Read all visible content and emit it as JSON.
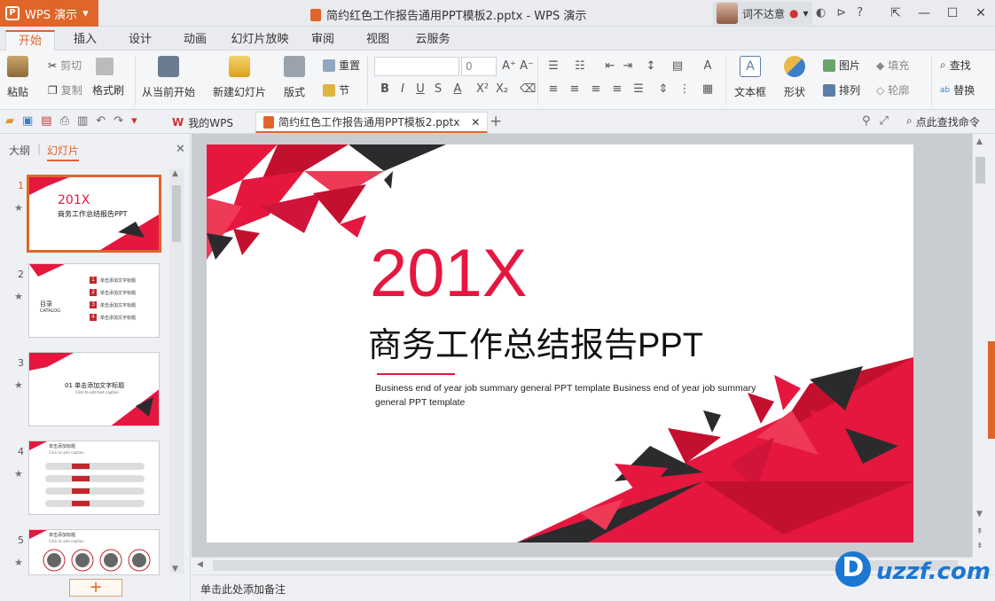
{
  "app": {
    "name": "WPS 演示",
    "doc_title": "简约红色工作报告通用PPT模板2.pptx - WPS 演示",
    "user": "词不达意"
  },
  "tabs": [
    "开始",
    "插入",
    "设计",
    "动画",
    "幻灯片放映",
    "审阅",
    "视图",
    "云服务"
  ],
  "ribbon": {
    "paste": "粘贴",
    "cut": "剪切",
    "copy": "复制",
    "format_painter": "格式刷",
    "from_current": "从当前开始",
    "new_slide": "新建幻灯片",
    "layout": "版式",
    "reset": "重置",
    "section": "节",
    "font_size": "0",
    "text_box": "文本框",
    "shape": "形状",
    "picture": "图片",
    "arrange": "排列",
    "fill": "填充",
    "outline": "轮廓",
    "find": "查找",
    "replace": "替换"
  },
  "doc_tabs": {
    "my_wps": "我的WPS",
    "file": "简约红色工作报告通用PPT模板2.pptx",
    "search": "点此查找命令"
  },
  "panel": {
    "outline_tab": "大纲",
    "slides_tab": "幻灯片",
    "add_button": "+"
  },
  "thumbnails": [
    {
      "num": "1",
      "year": "201X",
      "title": "商务工作总结报告PPT"
    },
    {
      "num": "2",
      "title": "目录",
      "subtitle": "CATALOG",
      "items": [
        "单击添加文字标题",
        "单击添加文字标题",
        "单击添加文字标题",
        "单击添加文字标题"
      ],
      "nums": [
        "1",
        "2",
        "3",
        "4"
      ]
    },
    {
      "num": "3",
      "heading": "01 单击添加文字标题",
      "sub": "Click to add text caption"
    },
    {
      "num": "4",
      "heading": "单击添加标题",
      "sub": "Click to add caption"
    },
    {
      "num": "5",
      "heading": "单击添加标题",
      "sub": "Click to add caption"
    }
  ],
  "slide": {
    "year": "201X",
    "title": "商务工作总结报告PPT",
    "subtitle": "Business end of year job summary general PPT template Business end of year job summary general PPT template"
  },
  "notes": "单击此处添加备注",
  "watermark": "uzzf.com",
  "colors": {
    "accent": "#e0652a",
    "red": "#e5173f",
    "dark": "#2b2b2e"
  }
}
